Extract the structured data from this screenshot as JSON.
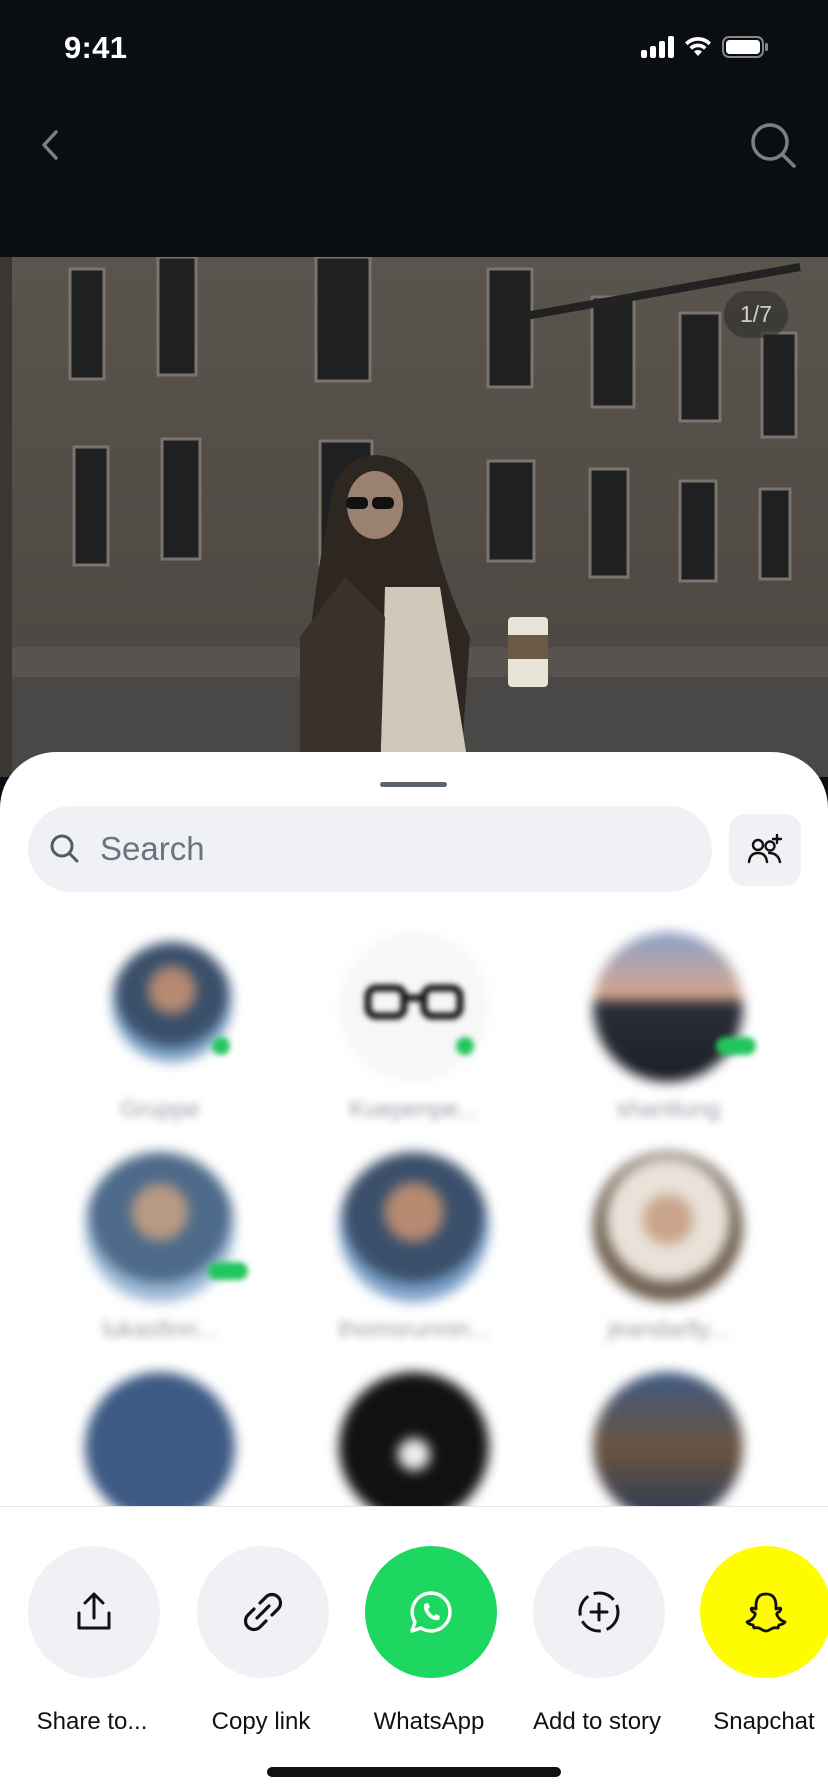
{
  "status_bar": {
    "time": "9:41"
  },
  "photo": {
    "page_indicator": "1/7"
  },
  "sheet": {
    "search": {
      "placeholder": "Search",
      "value": ""
    },
    "contacts": [
      {
        "name": "Gruppe",
        "online": true
      },
      {
        "name": "Kuepenpe...",
        "online": true
      },
      {
        "name": "shantlung",
        "online": true
      },
      {
        "name": "lukasfinn...",
        "online": true
      },
      {
        "name": "thomsrunnin...",
        "online": false
      },
      {
        "name": "jeandarlly...",
        "online": false
      },
      {
        "name": "",
        "online": false
      },
      {
        "name": "",
        "online": false
      },
      {
        "name": "",
        "online": false
      }
    ],
    "share_options": [
      {
        "label": "Share to...",
        "icon": "share-icon",
        "bg": "#eff1f5"
      },
      {
        "label": "Copy link",
        "icon": "link-icon",
        "bg": "#eff1f5"
      },
      {
        "label": "WhatsApp",
        "icon": "whatsapp-icon",
        "bg": "#1ed760"
      },
      {
        "label": "Add to story",
        "icon": "add-story-icon",
        "bg": "#eff1f5"
      },
      {
        "label": "Snapchat",
        "icon": "snapchat-icon",
        "bg": "#fffc00"
      }
    ]
  },
  "colors": {
    "whatsapp": "#1ed760",
    "snapchat": "#fffc00",
    "sheet_bg": "#ffffff",
    "header_bg": "#0a0e13"
  }
}
